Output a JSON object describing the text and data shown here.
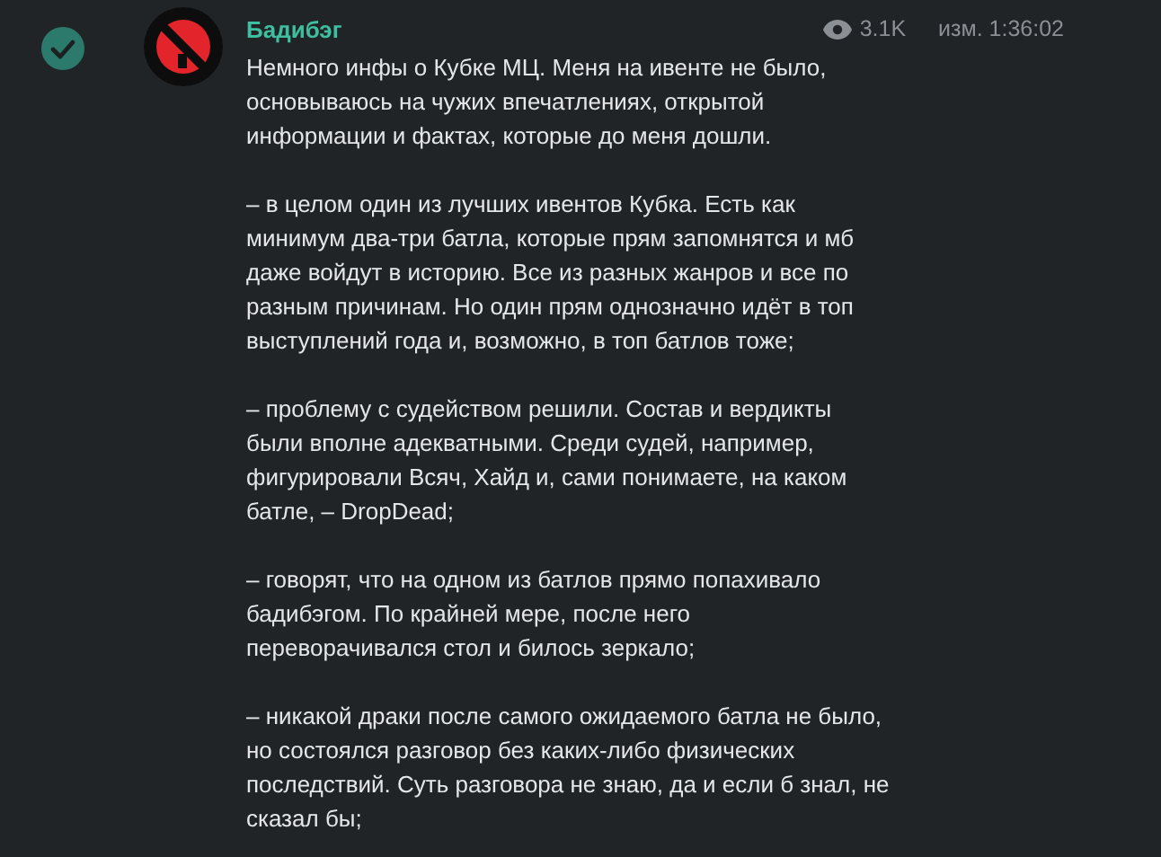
{
  "post": {
    "selected": true,
    "channel": "Бадибэг",
    "views": "3.1K",
    "edited": "изм. 1:36:02",
    "paragraphs": [
      [
        "Немного инфы о Кубке МЦ. Меня на ивенте не было,",
        "основываюсь на чужих впечатлениях, открытой",
        "информации и фактах, которые до меня дошли."
      ],
      [
        "– в целом один из лучших ивентов Кубка. Есть как",
        "минимум два-три батла, которые прям запомнятся и мб",
        "даже войдут в историю. Все из разных жанров и все по",
        "разным причинам. Но один прям однозначно идёт в топ",
        "выступлений года и, возможно, в топ батлов тоже;"
      ],
      [
        "– проблему с судейством решили. Состав и вердикты",
        "были вполне адекватными. Среди судей, например,",
        "фигурировали Всяч, Хайд и, сами понимаете, на каком",
        "батле, – DropDead;"
      ],
      [
        "– говорят, что на одном из батлов прямо попахивало",
        "бадибэгом. По крайней мере, после него",
        "переворачивался стол и билось зеркало;"
      ],
      [
        "– никакой драки после самого ожидаемого батла не было,",
        "но состоялся разговор без каких-либо физических",
        "последствий. Суть разговора не знаю, да и если б знал, не",
        "сказал бы;"
      ]
    ]
  }
}
